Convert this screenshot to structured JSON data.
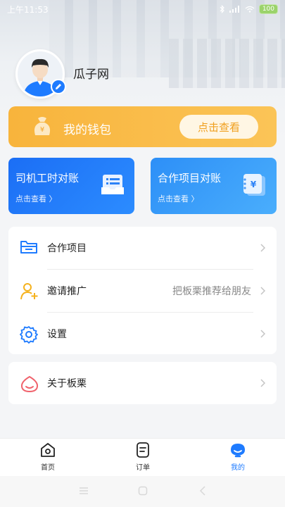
{
  "status_bar": {
    "time": "上午11:53",
    "battery": "100"
  },
  "profile": {
    "name": "瓜子网"
  },
  "wallet": {
    "title": "我的钱包",
    "button": "点击查看"
  },
  "cards": [
    {
      "title": "司机工时对账",
      "sub": "点击查看 〉"
    },
    {
      "title": "合作项目对账",
      "sub": "点击查看 〉"
    }
  ],
  "menu": [
    {
      "label": "合作项目",
      "extra": ""
    },
    {
      "label": "邀请推广",
      "extra": "把板栗推荐给朋友"
    },
    {
      "label": "设置",
      "extra": ""
    }
  ],
  "about": {
    "label": "关于板栗"
  },
  "tabs": [
    {
      "label": "首页",
      "active": false
    },
    {
      "label": "订单",
      "active": false
    },
    {
      "label": "我的",
      "active": true
    }
  ],
  "colors": {
    "primary": "#1e7bff",
    "wallet": "#f9b840",
    "active_tab": "#1e7bff"
  }
}
